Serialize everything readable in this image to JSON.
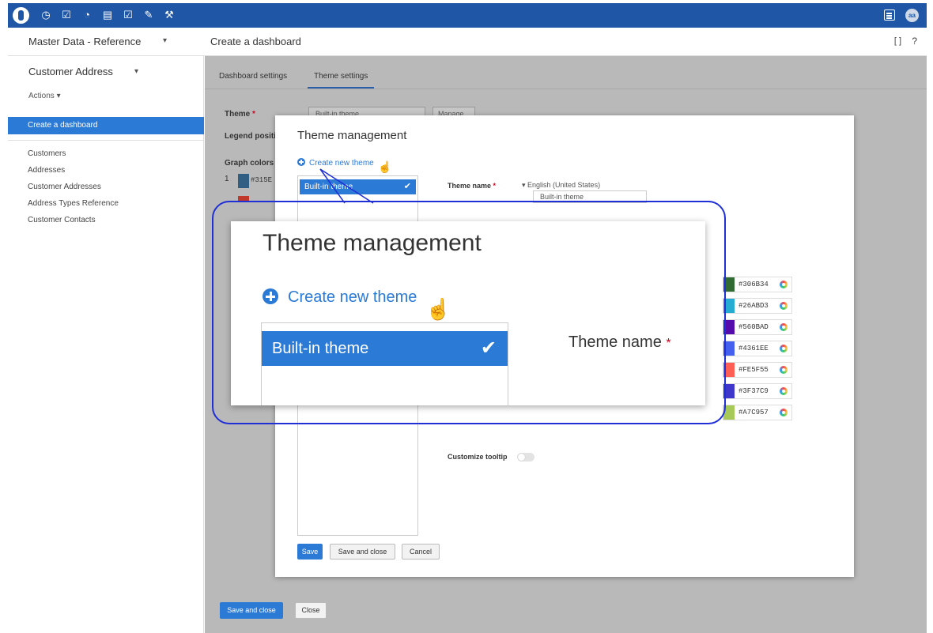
{
  "topbar": {
    "icons": [
      "database-icon",
      "clock-icon",
      "checkbox-icon",
      "gauge-icon",
      "document-icon",
      "check-doc-icon",
      "plug-icon",
      "wrench-icon"
    ],
    "icon_glyphs": [
      "◷",
      "☑",
      "◔",
      "▤",
      "☑",
      "✎",
      "⚒"
    ],
    "avatar": "aa"
  },
  "header": {
    "workspace": "Master Data - Reference",
    "title": "Create a dashboard",
    "help": "?",
    "expand": "[ ]"
  },
  "sidebar": {
    "entity": "Customer Address",
    "actions": "Actions ▾",
    "active_item": "Create a dashboard",
    "nav": [
      "Customers",
      "Addresses",
      "Customer Addresses",
      "Address Types Reference",
      "Customer Contacts"
    ]
  },
  "main": {
    "tabs": [
      "Dashboard settings",
      "Theme settings"
    ],
    "theme_label": "Theme",
    "theme_required": "*",
    "theme_value": "Built-in theme",
    "manage_label": "Manage",
    "legend_label": "Legend positio",
    "graph_colors_label": "Graph colors",
    "graph_row_index": "1",
    "graph_row_hex": "#315E",
    "save_and_close": "Save and close",
    "close": "Close"
  },
  "dialog": {
    "title": "Theme management",
    "create_new": "Create new theme",
    "list_item": "Built-in theme",
    "theme_name_label": "Theme name",
    "required": "*",
    "language": "▾ English (United States)",
    "theme_name_value": "Built-in theme",
    "colors": [
      {
        "hex": "#306B34",
        "color": "#306B34"
      },
      {
        "hex": "#26ABD3",
        "color": "#26ABD3"
      },
      {
        "hex": "#560BAD",
        "color": "#560BAD"
      },
      {
        "hex": "#4361EE",
        "color": "#4361EE"
      },
      {
        "hex": "#FE5F55",
        "color": "#FE5F55"
      },
      {
        "hex": "#3F37C9",
        "color": "#3F37C9"
      },
      {
        "hex": "#A7C957",
        "color": "#A7C957"
      }
    ],
    "customize_tooltip": "Customize tooltip",
    "save": "Save",
    "save_and_close": "Save and close",
    "cancel": "Cancel"
  },
  "zoom": {
    "title": "Theme management",
    "create_new": "Create new theme",
    "list_item": "Built-in theme",
    "theme_name_label": "Theme name",
    "required": "*"
  },
  "colors": {
    "topbar": "#1f56a5",
    "accent": "#2b7ad6",
    "callout": "#1f2fd6",
    "graph_row_swatch": "#315E83",
    "graph_row_swatch_2": "#c0392b"
  }
}
